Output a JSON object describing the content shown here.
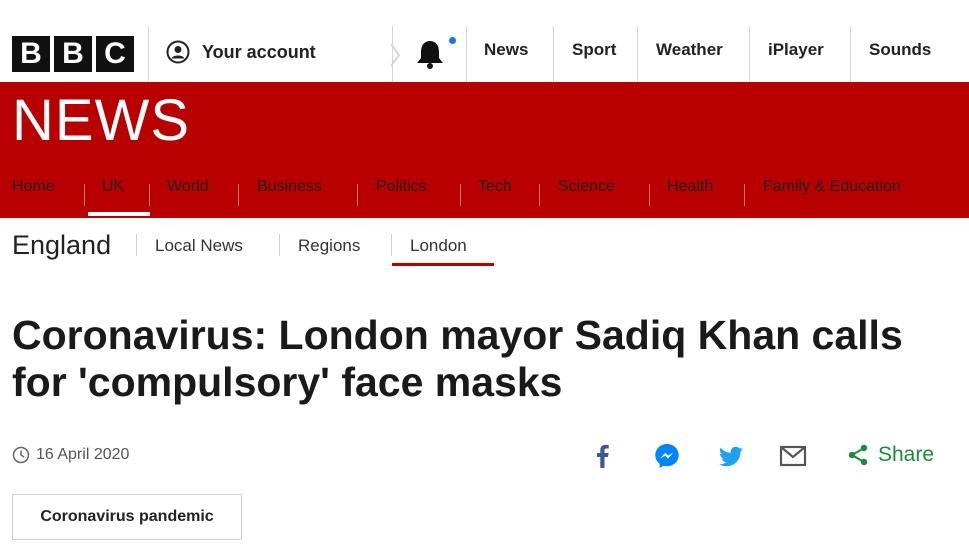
{
  "brand": {
    "letters": [
      "B",
      "B",
      "C"
    ]
  },
  "top_nav": {
    "account": "Your account",
    "items": [
      "News",
      "Sport",
      "Weather",
      "iPlayer",
      "Sounds"
    ]
  },
  "section_wordmark": "NEWS",
  "red_nav": {
    "items": [
      "Home",
      "UK",
      "World",
      "Business",
      "Politics",
      "Tech",
      "Science",
      "Health",
      "Family & Education"
    ],
    "selected": "UK"
  },
  "subnav": {
    "title": "England",
    "items": [
      "Local News",
      "Regions",
      "London"
    ],
    "selected": "London"
  },
  "article": {
    "headline": "Coronavirus: London mayor Sadiq Khan calls for 'compulsory' face masks",
    "date": "16 April 2020",
    "tag": "Coronavirus pandemic"
  },
  "share": {
    "label": "Share",
    "icons": [
      "facebook-icon",
      "messenger-icon",
      "twitter-icon",
      "email-icon",
      "share-icon"
    ]
  },
  "colors": {
    "brand_red": "#b80000",
    "share_green": "#1a8a3c",
    "facebook_blue": "#3b5998",
    "messenger_blue": "#0084ff",
    "twitter_blue": "#1da1f2",
    "notification_dot": "#1a73e8"
  }
}
